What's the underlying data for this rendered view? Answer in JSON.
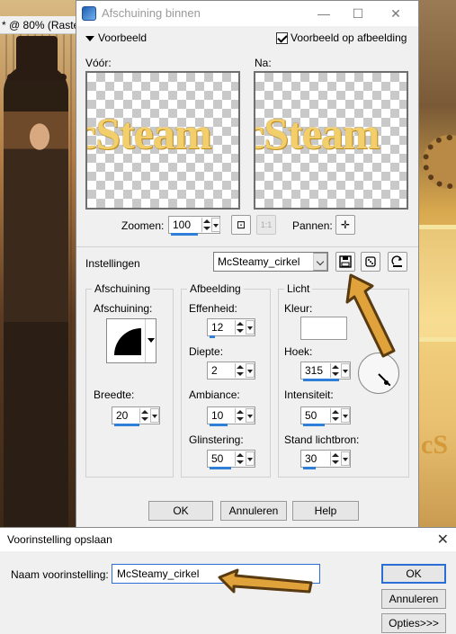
{
  "background_app": {
    "tab_label": "* @  80% (Raste"
  },
  "dialog": {
    "title": "Afschuining binnen",
    "window_buttons": [
      "—",
      "☐",
      "✕"
    ],
    "preview_section_label": "Voorbeeld",
    "preview_on_image_label": "Voorbeeld op afbeelding",
    "preview_on_image_checked": true,
    "before_label": "Vóór:",
    "after_label": "Na:",
    "preview_art_text": "cSteam",
    "zoom_label": "Zoomen:",
    "zoom_value": "100",
    "pan_label": "Pannen:",
    "settings_label": "Instellingen",
    "preset_value": "McSteamy_cirkel",
    "bevel_group": {
      "title": "Afschuining",
      "bevel_label": "Afschuining:",
      "width_label": "Breedte:",
      "width_value": "20"
    },
    "image_group": {
      "title": "Afbeelding",
      "smoothness_label": "Effenheid:",
      "smoothness_value": "12",
      "depth_label": "Diepte:",
      "depth_value": "2",
      "ambience_label": "Ambiance:",
      "ambience_value": "10",
      "shininess_label": "Glinstering:",
      "shininess_value": "50"
    },
    "light_group": {
      "title": "Licht",
      "color_label": "Kleur:",
      "color_value": "#ffffff",
      "angle_label": "Hoek:",
      "angle_value": "315",
      "intensity_label": "Intensiteit:",
      "intensity_value": "50",
      "elevation_label": "Stand lichtbron:",
      "elevation_value": "30"
    },
    "buttons": {
      "ok": "OK",
      "cancel": "Annuleren",
      "help": "Help"
    }
  },
  "save_preset_dialog": {
    "title": "Voorinstelling opslaan",
    "close": "✕",
    "name_label": "Naam voorinstelling:",
    "name_value": "McSteamy_cirkel",
    "ok": "OK",
    "cancel": "Annuleren",
    "options": "Opties>>>"
  },
  "colors": {
    "accent": "#2b6ed6",
    "annotation_arrow": "#8b5a16",
    "annotation_arrow_fill": "#e0a23a"
  }
}
